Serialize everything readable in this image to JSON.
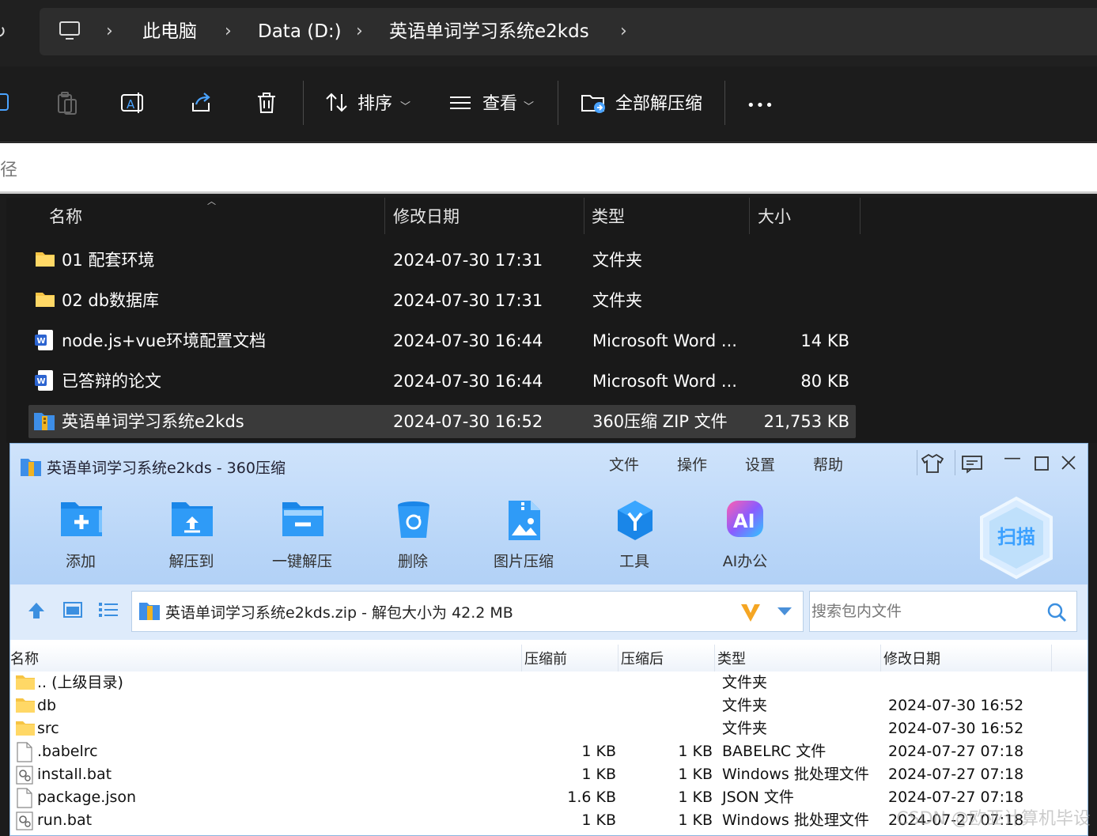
{
  "explorer": {
    "breadcrumb": [
      "此电脑",
      "Data (D:)",
      "英语单词学习系统e2kds"
    ],
    "toolbar": {
      "sort_label": "排序",
      "view_label": "查看",
      "extract_all_label": "全部解压缩",
      "more_label": "•••"
    },
    "path_hint": "径",
    "columns": [
      "名称",
      "修改日期",
      "类型",
      "大小"
    ],
    "rows": [
      {
        "name": "01 配套环境",
        "date": "2024-07-30 17:31",
        "type": "文件夹",
        "size": "",
        "icon": "folder-icon"
      },
      {
        "name": "02 db数据库",
        "date": "2024-07-30 17:31",
        "type": "文件夹",
        "size": "",
        "icon": "folder-icon"
      },
      {
        "name": "node.js+vue环境配置文档",
        "date": "2024-07-30 16:44",
        "type": "Microsoft Word ...",
        "size": "14 KB",
        "icon": "word-doc-icon"
      },
      {
        "name": "已答辩的论文",
        "date": "2024-07-30 16:44",
        "type": "Microsoft Word ...",
        "size": "80 KB",
        "icon": "word-doc-icon"
      },
      {
        "name": "英语单词学习系统e2kds",
        "date": "2024-07-30 16:52",
        "type": "360压缩 ZIP 文件",
        "size": "21,753 KB",
        "icon": "zip-archive-icon"
      }
    ]
  },
  "zip": {
    "title": "英语单词学习系统e2kds - 360压缩",
    "menu": [
      "文件",
      "操作",
      "设置",
      "帮助"
    ],
    "toolbar": [
      {
        "label": "添加",
        "icon": "add-folder-icon"
      },
      {
        "label": "解压到",
        "icon": "extract-to-icon"
      },
      {
        "label": "一键解压",
        "icon": "one-click-extract-icon"
      },
      {
        "label": "删除",
        "icon": "recycle-bin-icon"
      },
      {
        "label": "图片压缩",
        "icon": "image-compress-icon"
      },
      {
        "label": "工具",
        "icon": "tools-icon"
      },
      {
        "label": "AI办公",
        "icon": "ai-office-icon"
      }
    ],
    "scan_label": "扫描",
    "path_text": "英语单词学习系统e2kds.zip - 解包大小为 42.2 MB",
    "search_placeholder": "搜索包内文件",
    "columns": [
      "名称",
      "压缩前",
      "压缩后",
      "类型",
      "修改日期"
    ],
    "rows": [
      {
        "name": ".. (上级目录)",
        "before": "",
        "after": "",
        "type": "文件夹",
        "date": "",
        "icon": "folder-icon"
      },
      {
        "name": "db",
        "before": "",
        "after": "",
        "type": "文件夹",
        "date": "2024-07-30 16:52",
        "icon": "folder-icon"
      },
      {
        "name": "src",
        "before": "",
        "after": "",
        "type": "文件夹",
        "date": "2024-07-30 16:52",
        "icon": "folder-icon"
      },
      {
        "name": ".babelrc",
        "before": "1 KB",
        "after": "1 KB",
        "type": "BABELRC 文件",
        "date": "2024-07-27 07:18",
        "icon": "file-icon"
      },
      {
        "name": "install.bat",
        "before": "1 KB",
        "after": "1 KB",
        "type": "Windows 批处理文件",
        "date": "2024-07-27 07:18",
        "icon": "batch-file-icon"
      },
      {
        "name": "package.json",
        "before": "1.6 KB",
        "after": "1 KB",
        "type": "JSON 文件",
        "date": "2024-07-27 07:18",
        "icon": "file-icon"
      },
      {
        "name": "run.bat",
        "before": "1 KB",
        "after": "1 KB",
        "type": "Windows 批处理文件",
        "date": "2024-07-27 07:18",
        "icon": "batch-file-icon"
      }
    ],
    "watermark": "CSDN @欧亚计算机毕设"
  }
}
